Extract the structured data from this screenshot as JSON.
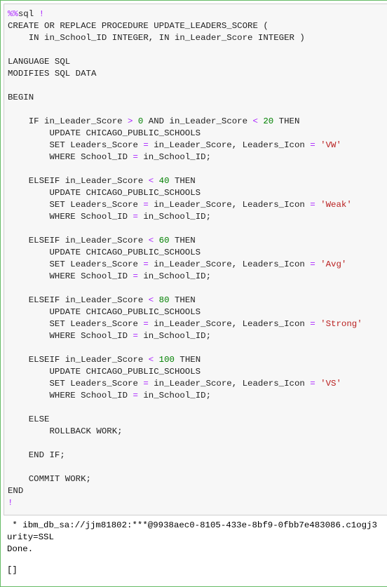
{
  "cell": {
    "lines": [
      [
        {
          "t": "%%",
          "k": "magic"
        },
        {
          "t": "sql ",
          "k": "txt"
        },
        {
          "t": "!",
          "k": "op"
        }
      ],
      [
        {
          "t": "CREATE OR REPLACE PROCEDURE UPDATE_LEADERS_SCORE (",
          "k": "txt"
        }
      ],
      [
        {
          "t": "    IN in_School_ID INTEGER, IN in_Leader_Score INTEGER )",
          "k": "txt"
        }
      ],
      [],
      [
        {
          "t": "LANGUAGE SQL",
          "k": "txt"
        }
      ],
      [
        {
          "t": "MODIFIES SQL DATA",
          "k": "txt"
        }
      ],
      [],
      [
        {
          "t": "BEGIN",
          "k": "txt"
        }
      ],
      [],
      [
        {
          "t": "    IF in_Leader_Score ",
          "k": "txt"
        },
        {
          "t": ">",
          "k": "op"
        },
        {
          "t": " ",
          "k": "txt"
        },
        {
          "t": "0",
          "k": "num"
        },
        {
          "t": " AND in_Leader_Score ",
          "k": "txt"
        },
        {
          "t": "<",
          "k": "op"
        },
        {
          "t": " ",
          "k": "txt"
        },
        {
          "t": "20",
          "k": "num"
        },
        {
          "t": " THEN",
          "k": "txt"
        }
      ],
      [
        {
          "t": "        UPDATE CHICAGO_PUBLIC_SCHOOLS",
          "k": "txt"
        }
      ],
      [
        {
          "t": "        SET Leaders_Score ",
          "k": "txt"
        },
        {
          "t": "=",
          "k": "op"
        },
        {
          "t": " in_Leader_Score, Leaders_Icon ",
          "k": "txt"
        },
        {
          "t": "=",
          "k": "op"
        },
        {
          "t": " ",
          "k": "txt"
        },
        {
          "t": "'VW'",
          "k": "str"
        }
      ],
      [
        {
          "t": "        WHERE School_ID ",
          "k": "txt"
        },
        {
          "t": "=",
          "k": "op"
        },
        {
          "t": " in_School_ID;",
          "k": "txt"
        }
      ],
      [],
      [
        {
          "t": "    ELSEIF in_Leader_Score ",
          "k": "txt"
        },
        {
          "t": "<",
          "k": "op"
        },
        {
          "t": " ",
          "k": "txt"
        },
        {
          "t": "40",
          "k": "num"
        },
        {
          "t": " THEN",
          "k": "txt"
        }
      ],
      [
        {
          "t": "        UPDATE CHICAGO_PUBLIC_SCHOOLS",
          "k": "txt"
        }
      ],
      [
        {
          "t": "        SET Leaders_Score ",
          "k": "txt"
        },
        {
          "t": "=",
          "k": "op"
        },
        {
          "t": " in_Leader_Score, Leaders_Icon ",
          "k": "txt"
        },
        {
          "t": "=",
          "k": "op"
        },
        {
          "t": " ",
          "k": "txt"
        },
        {
          "t": "'Weak'",
          "k": "str"
        }
      ],
      [
        {
          "t": "        WHERE School_ID ",
          "k": "txt"
        },
        {
          "t": "=",
          "k": "op"
        },
        {
          "t": " in_School_ID;",
          "k": "txt"
        }
      ],
      [],
      [
        {
          "t": "    ELSEIF in_Leader_Score ",
          "k": "txt"
        },
        {
          "t": "<",
          "k": "op"
        },
        {
          "t": " ",
          "k": "txt"
        },
        {
          "t": "60",
          "k": "num"
        },
        {
          "t": " THEN",
          "k": "txt"
        }
      ],
      [
        {
          "t": "        UPDATE CHICAGO_PUBLIC_SCHOOLS",
          "k": "txt"
        }
      ],
      [
        {
          "t": "        SET Leaders_Score ",
          "k": "txt"
        },
        {
          "t": "=",
          "k": "op"
        },
        {
          "t": " in_Leader_Score, Leaders_Icon ",
          "k": "txt"
        },
        {
          "t": "=",
          "k": "op"
        },
        {
          "t": " ",
          "k": "txt"
        },
        {
          "t": "'Avg'",
          "k": "str"
        }
      ],
      [
        {
          "t": "        WHERE School_ID ",
          "k": "txt"
        },
        {
          "t": "=",
          "k": "op"
        },
        {
          "t": " in_School_ID;",
          "k": "txt"
        }
      ],
      [],
      [
        {
          "t": "    ELSEIF in_Leader_Score ",
          "k": "txt"
        },
        {
          "t": "<",
          "k": "op"
        },
        {
          "t": " ",
          "k": "txt"
        },
        {
          "t": "80",
          "k": "num"
        },
        {
          "t": " THEN",
          "k": "txt"
        }
      ],
      [
        {
          "t": "        UPDATE CHICAGO_PUBLIC_SCHOOLS",
          "k": "txt"
        }
      ],
      [
        {
          "t": "        SET Leaders_Score ",
          "k": "txt"
        },
        {
          "t": "=",
          "k": "op"
        },
        {
          "t": " in_Leader_Score, Leaders_Icon ",
          "k": "txt"
        },
        {
          "t": "=",
          "k": "op"
        },
        {
          "t": " ",
          "k": "txt"
        },
        {
          "t": "'Strong'",
          "k": "str"
        }
      ],
      [
        {
          "t": "        WHERE School_ID ",
          "k": "txt"
        },
        {
          "t": "=",
          "k": "op"
        },
        {
          "t": " in_School_ID;",
          "k": "txt"
        }
      ],
      [],
      [
        {
          "t": "    ELSEIF in_Leader_Score ",
          "k": "txt"
        },
        {
          "t": "<",
          "k": "op"
        },
        {
          "t": " ",
          "k": "txt"
        },
        {
          "t": "100",
          "k": "num"
        },
        {
          "t": " THEN",
          "k": "txt"
        }
      ],
      [
        {
          "t": "        UPDATE CHICAGO_PUBLIC_SCHOOLS",
          "k": "txt"
        }
      ],
      [
        {
          "t": "        SET Leaders_Score ",
          "k": "txt"
        },
        {
          "t": "=",
          "k": "op"
        },
        {
          "t": " in_Leader_Score, Leaders_Icon ",
          "k": "txt"
        },
        {
          "t": "=",
          "k": "op"
        },
        {
          "t": " ",
          "k": "txt"
        },
        {
          "t": "'VS'",
          "k": "str"
        }
      ],
      [
        {
          "t": "        WHERE School_ID ",
          "k": "txt"
        },
        {
          "t": "=",
          "k": "op"
        },
        {
          "t": " in_School_ID;",
          "k": "txt"
        }
      ],
      [],
      [
        {
          "t": "    ELSE",
          "k": "txt"
        }
      ],
      [
        {
          "t": "        ROLLBACK WORK;",
          "k": "txt"
        }
      ],
      [],
      [
        {
          "t": "    END IF;",
          "k": "txt"
        }
      ],
      [],
      [
        {
          "t": "    COMMIT WORK;",
          "k": "txt"
        }
      ],
      [
        {
          "t": "END",
          "k": "txt"
        }
      ],
      [
        {
          "t": "!",
          "k": "op"
        }
      ]
    ]
  },
  "output": {
    "connection_line": " * ibm_db_sa://jjm81802:***@9938aec0-8105-433e-8bf9-0fbb7e483086.c1ogj3",
    "security_line": "urity=SSL",
    "status": "Done.",
    "result": "[]"
  },
  "colors": {
    "magic": "#aa22ff",
    "operator": "#aa22ff",
    "number": "#008000",
    "string": "#ba2121",
    "text": "#222222",
    "cell_border": "#66bb66",
    "input_background": "#f7f7f7"
  }
}
